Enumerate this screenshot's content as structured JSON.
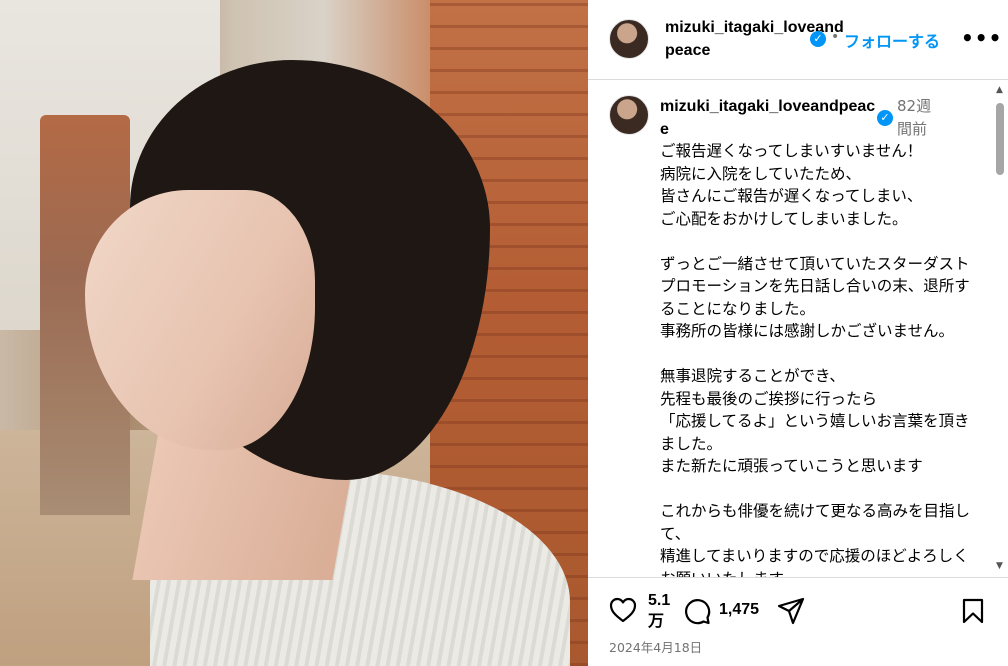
{
  "post": {
    "username": "mizuki_itagaki_loveandpeace",
    "verified_mark": "✓",
    "separator": "•",
    "follow_label": "フォローする",
    "more_label": "•••"
  },
  "comment": {
    "username": "mizuki_itagaki_loveandpeace",
    "time": "82週間前",
    "body": "ご報告遅くなってしまいすいません！\n病院に入院をしていたため、\n皆さんにご報告が遅くなってしまい、\nご心配をおかけしてしまいました。\n\nずっとご一緒させて頂いていたスターダストプロモーションを先日話し合いの末、退所することになりました。\n事務所の皆様には感謝しかございません。\n\n無事退院することができ、\n先程も最後のご挨拶に行ったら\n「応援してるよ」という嬉しいお言葉を頂きました。\nまた新たに頑張っていこうと思います\n\nこれからも俳優を続けて更なる高みを目指して、\n精進してまいりますので応援のほどよろしくお願いいたします。"
  },
  "scrollbar": {
    "up": "▲",
    "down": "▼"
  },
  "actions": {
    "like_count": "5.1万",
    "comment_count": "1,475",
    "date": "2024年4月18日",
    "icons": [
      "heart-icon",
      "comment-icon",
      "share-icon",
      "bookmark-icon"
    ]
  },
  "colors": {
    "accent": "#0095f6",
    "muted": "#737373",
    "border": "#dbdbdb"
  }
}
